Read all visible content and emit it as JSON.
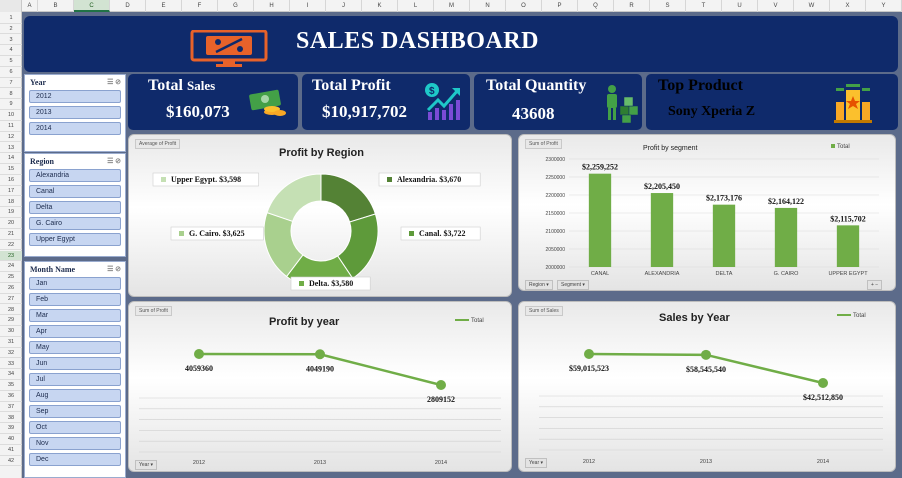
{
  "columns": [
    "A",
    "B",
    "C",
    "D",
    "E",
    "F",
    "G",
    "H",
    "I",
    "J",
    "K",
    "L",
    "M",
    "N",
    "O",
    "P",
    "Q",
    "R",
    "S",
    "T",
    "U",
    "V",
    "W",
    "X",
    "Y"
  ],
  "selected_column": "C",
  "rows": [
    "1",
    "2",
    "3",
    "4",
    "5",
    "6",
    "7",
    "8",
    "9",
    "10",
    "11",
    "12",
    "13",
    "14",
    "15",
    "16",
    "17",
    "18",
    "19",
    "20",
    "21",
    "22",
    "23",
    "24",
    "25",
    "26",
    "27",
    "28",
    "29",
    "30",
    "31",
    "32",
    "33",
    "34",
    "35",
    "36",
    "37",
    "38",
    "39",
    "40",
    "41",
    "42"
  ],
  "selected_row": "23",
  "dashboard": {
    "title": "SALES DASHBOARD"
  },
  "slicers": {
    "year": {
      "title": "Year",
      "items": [
        "2012",
        "2013",
        "2014"
      ]
    },
    "region": {
      "title": "Region",
      "items": [
        "Alexandria",
        "Canal",
        "Delta",
        "G. Cairo",
        "Upper Egypt"
      ]
    },
    "month": {
      "title": "Month Name",
      "items": [
        "Jan",
        "Feb",
        "Mar",
        "Apr",
        "May",
        "Jun",
        "Jul",
        "Aug",
        "Sep",
        "Oct",
        "Nov",
        "Dec"
      ]
    }
  },
  "kpis": {
    "total_sales": {
      "label_main": "Total",
      "label_sub": "Sales",
      "value": "$160,073"
    },
    "total_profit": {
      "label": "Total Profit",
      "value": "$10,917,702"
    },
    "total_quantity": {
      "label": "Total Quantity",
      "value": "43608"
    },
    "top_product": {
      "label": "Top Product",
      "value": "Sony Xperia Z"
    }
  },
  "chart_data": [
    {
      "type": "pie",
      "title": "Profit by Region",
      "tag": "Average of Profit",
      "categories": [
        "Alexandria",
        "Canal",
        "Delta",
        "G. Cairo",
        "Upper Egypt"
      ],
      "values": [
        3670,
        3722,
        3580,
        3625,
        3598
      ],
      "data_labels": [
        "Alexandria. $3,670",
        "Canal. $3,722",
        "Delta. $3,580",
        "G. Cairo. $3,625",
        "Upper Egypt. $3,598"
      ],
      "colors": [
        "#548235",
        "#5e9a3a",
        "#70ad47",
        "#a9d08e",
        "#c5e0b4"
      ]
    },
    {
      "type": "bar",
      "title": "Profit by segment",
      "tag": "Sum of Profit",
      "legend": "Total",
      "categories": [
        "CANAL",
        "ALEXANDRIA",
        "DELTA",
        "G. CAIRO",
        "UPPER EGYPT"
      ],
      "values": [
        2259252,
        2205450,
        2173176,
        2164122,
        2115702
      ],
      "data_labels": [
        "$2,259,252",
        "$2,205,450",
        "$2,173,176",
        "$2,164,122",
        "$2,115,702"
      ],
      "yticks": [
        "2000000",
        "2050000",
        "2100000",
        "2150000",
        "2200000",
        "2250000",
        "2300000"
      ],
      "ylim": [
        2000000,
        2300000
      ],
      "filters": [
        "Region",
        "Segment"
      ]
    },
    {
      "type": "line",
      "title": "Profit by year",
      "tag": "Sum of Profit",
      "legend": "Total",
      "x": [
        "2012",
        "2013",
        "2014"
      ],
      "values": [
        4059360,
        4049190,
        2809152
      ],
      "data_labels": [
        "4059360",
        "4049190",
        "2809152"
      ],
      "filter": "Year"
    },
    {
      "type": "line",
      "title": "Sales by Year",
      "tag": "Sum of Sales",
      "legend": "Total",
      "x": [
        "2012",
        "2013",
        "2014"
      ],
      "values": [
        59015523,
        58545540,
        42512850
      ],
      "data_labels": [
        "$59,015,523",
        "$58,545,540",
        "$42,512,850"
      ],
      "filter": "Year"
    }
  ],
  "colors": {
    "navy": "#0f2a6b",
    "green": "#70ad47",
    "slicer_blue": "#c7d6f1",
    "background": "#5c6b8a"
  }
}
